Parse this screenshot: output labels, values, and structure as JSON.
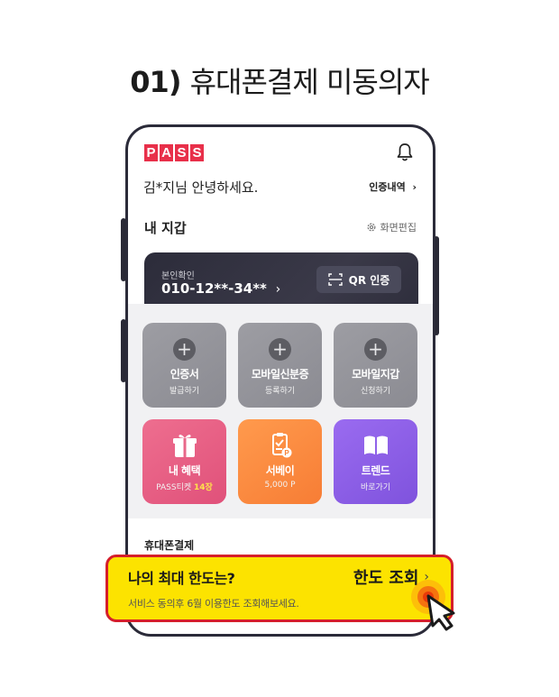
{
  "heading": {
    "number": "01)",
    "text": "휴대폰결제 미동의자"
  },
  "app": {
    "logo_letters": [
      "P",
      "A",
      "S",
      "S"
    ],
    "greeting": "김*지님 안녕하세요.",
    "history_link": "인증내역",
    "wallet_title": "내 지갑",
    "edit_screen": "화면편집",
    "id_card": {
      "label": "본인확인",
      "number": "010-12**-34**",
      "qr_button": "QR 인증"
    },
    "tiles": [
      {
        "title": "인증서",
        "sub": "발급하기"
      },
      {
        "title": "모바일신분증",
        "sub": "등록하기"
      },
      {
        "title": "모바일지갑",
        "sub": "신청하기"
      },
      {
        "title": "내 혜택",
        "sub": "PASS티켓",
        "sub_highlight": "14장"
      },
      {
        "title": "서베이",
        "sub": "5,000 P"
      },
      {
        "title": "트렌드",
        "sub": "바로가기"
      }
    ],
    "mobile_pay_title": "휴대폰결제"
  },
  "banner": {
    "question": "나의 최대 한도는?",
    "cta": "한도 조회",
    "description": "서비스 동의후 6월 이용한도 조회해보세요."
  },
  "colors": {
    "brand_red": "#e8304a",
    "banner_yellow": "#fce300",
    "banner_border": "#d51f2b",
    "tile_pink": "#e9607f",
    "tile_orange": "#fb8a40",
    "tile_purple": "#8d5ee8",
    "tile_gray": "#95959b"
  },
  "icons": [
    "bell-icon",
    "gear-icon",
    "qr-scan-icon",
    "plus-icon",
    "gift-icon",
    "clipboard-icon",
    "book-icon",
    "hand-pointer-icon"
  ]
}
